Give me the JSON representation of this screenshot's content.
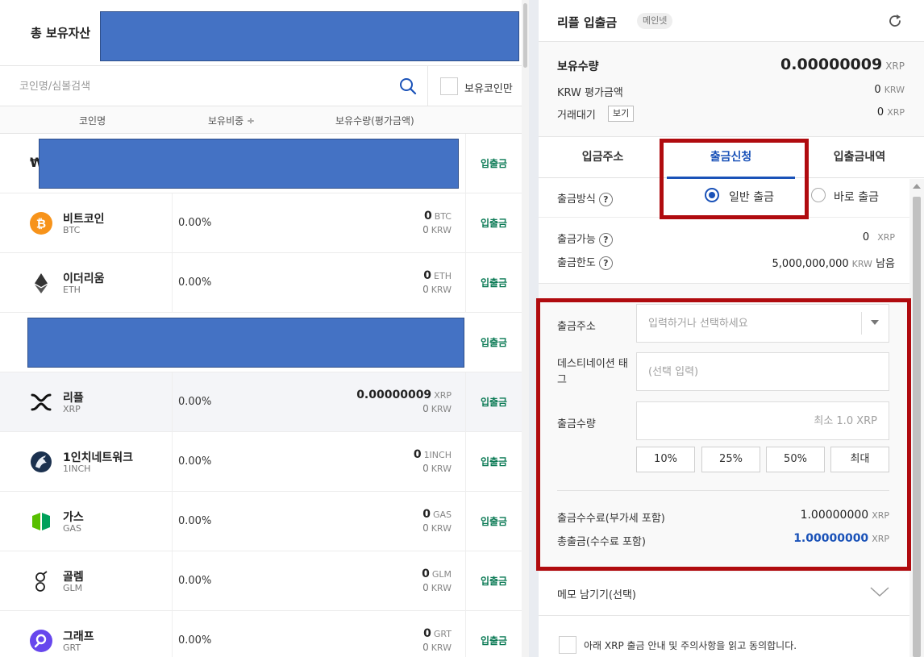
{
  "left": {
    "total_assets_label": "총 보유자산",
    "search_placeholder": "코인명/심볼검색",
    "own_coins_label": "보유코인만",
    "columns": {
      "name": "코인명",
      "ratio": "보유비중 ÷",
      "qty": "보유수량(평가금액)"
    },
    "krw_mark": "₩",
    "deposit_label": "입출금",
    "coins": [
      {
        "name": "비트코인",
        "symbol": "BTC",
        "ratio": "0.00%",
        "qty": "0",
        "qty_unit": "BTC",
        "krw": "0",
        "krw_unit": "KRW",
        "icon": "bitcoin-icon"
      },
      {
        "name": "이더리움",
        "symbol": "ETH",
        "ratio": "0.00%",
        "qty": "0",
        "qty_unit": "ETH",
        "krw": "0",
        "krw_unit": "KRW",
        "icon": "ethereum-icon"
      },
      {
        "name": "리플",
        "symbol": "XRP",
        "ratio": "0.00%",
        "qty": "0.00000009",
        "qty_unit": "XRP",
        "krw": "0",
        "krw_unit": "KRW",
        "icon": "ripple-icon"
      },
      {
        "name": "1인치네트워크",
        "symbol": "1INCH",
        "ratio": "0.00%",
        "qty": "0",
        "qty_unit": "1INCH",
        "krw": "0",
        "krw_unit": "KRW",
        "icon": "1inch-icon"
      },
      {
        "name": "가스",
        "symbol": "GAS",
        "ratio": "0.00%",
        "qty": "0",
        "qty_unit": "GAS",
        "krw": "0",
        "krw_unit": "KRW",
        "icon": "gas-icon"
      },
      {
        "name": "골렘",
        "symbol": "GLM",
        "ratio": "0.00%",
        "qty": "0",
        "qty_unit": "GLM",
        "krw": "0",
        "krw_unit": "KRW",
        "icon": "golem-icon"
      },
      {
        "name": "그래프",
        "symbol": "GRT",
        "ratio": "0.00%",
        "qty": "0",
        "qty_unit": "GRT",
        "krw": "0",
        "krw_unit": "KRW",
        "icon": "graph-icon"
      }
    ]
  },
  "right": {
    "title": "리플 입출금",
    "network_badge": "메인넷",
    "holdings_label": "보유수량",
    "holdings_value": "0.00000009",
    "holdings_unit": "XRP",
    "krw_eval_label": "KRW 평가금액",
    "krw_eval_value": "0",
    "krw_eval_unit": "KRW",
    "pending_label": "거래대기",
    "view_label": "보기",
    "pending_value": "0",
    "pending_unit": "XRP",
    "tabs": [
      "입금주소",
      "출금신청",
      "입출금내역"
    ],
    "method_label": "출금방식",
    "help_glyph": "?",
    "method_normal": "일반 출금",
    "method_instant": "바로 출금",
    "available_label": "출금가능",
    "available_value": "0",
    "available_unit": "XRP",
    "limit_label": "출금한도",
    "limit_value": "5,000,000,000",
    "limit_unit": "KRW",
    "limit_suffix": "남음",
    "address_label": "출금주소",
    "address_placeholder": "입력하거나 선택하세요",
    "dest_tag_label": "데스티네이션 태그",
    "dest_tag_placeholder": "(선택 입력)",
    "amount_label": "출금수량",
    "amount_placeholder": "최소 1.0 XRP",
    "pct_buttons": [
      "10%",
      "25%",
      "50%",
      "최대"
    ],
    "fee_label": "출금수수료(부가세 포함)",
    "fee_value": "1.00000000",
    "fee_unit": "XRP",
    "total_label": "총출금(수수료 포함)",
    "total_value": "1.00000000",
    "total_unit": "XRP",
    "memo_label": "메모 남기기(선택)",
    "agree_label": "아래 XRP 출금 안내 및 주의사항을 읽고 동의합니다."
  },
  "colors": {
    "accent": "#1a52b8",
    "deposit_green": "#0b7a55",
    "highlight_red": "#b00b0f",
    "redaction_blue": "#4472c4"
  }
}
